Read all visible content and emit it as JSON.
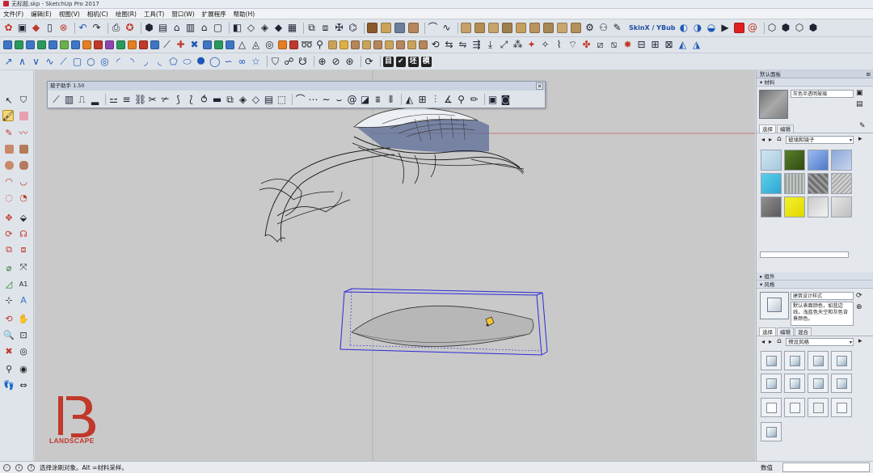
{
  "window": {
    "title": "无标题.skp - SketchUp Pro 2017"
  },
  "menu": {
    "items": [
      "文件(F)",
      "编辑(E)",
      "视图(V)",
      "相机(C)",
      "绘图(R)",
      "工具(T)",
      "窗口(W)",
      "扩展程序",
      "帮助(H)"
    ]
  },
  "toolbar": {
    "skinx_label": "SkinX / YBub",
    "toggle_labels": [
      "目",
      "✔",
      "坯",
      "模"
    ]
  },
  "floating_toolbar": {
    "title": "玻子助手 1.50"
  },
  "panel": {
    "tray_title": "默认面板",
    "materials": {
      "header": "材料",
      "name_value": "灰色半透明玻璃",
      "tabs": [
        "选择",
        "编辑"
      ],
      "library": "玻璃和镜子"
    },
    "components_header": "组件",
    "styles": {
      "header": "风格",
      "name_value": "建筑设计样式",
      "description": "默认表面颜色，如蓝边线，浅蓝色天空和灰色背景颜色。",
      "tabs": [
        "选择",
        "编辑",
        "混合"
      ],
      "library": "预设风格"
    }
  },
  "status": {
    "text": "选择涂刷对象。Alt =材料采样。",
    "measure_label": "数值"
  },
  "logo": {
    "text": "LANDSCAPE"
  },
  "colors": {
    "accent_red": "#c0392b",
    "selection_blue": "#2a2ad8"
  }
}
